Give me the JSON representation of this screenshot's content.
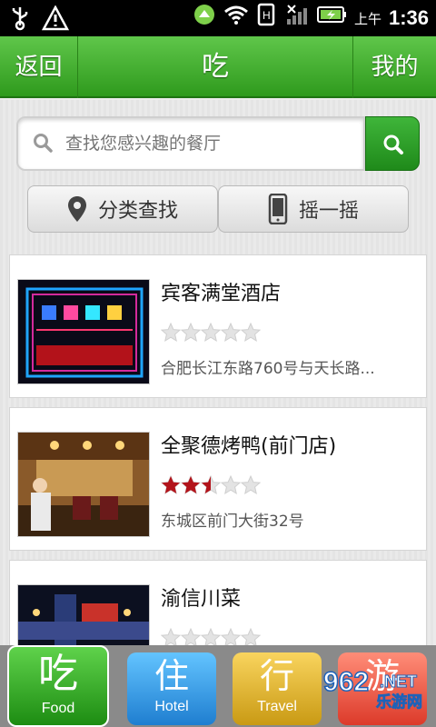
{
  "statusbar": {
    "ampm": "上午",
    "time": "1:36"
  },
  "titlebar": {
    "back_label": "返回",
    "title": "吃",
    "mine_label": "我的"
  },
  "search": {
    "placeholder": "查找您感兴趣的餐厅"
  },
  "tools": {
    "category_label": "分类查找",
    "shake_label": "摇一摇"
  },
  "restaurants": [
    {
      "name": "宾客满堂酒店",
      "rating": 0,
      "address": "合肥长江东路760号与天长路..."
    },
    {
      "name": "全聚德烤鸭(前门店)",
      "rating": 2.5,
      "address": "东城区前门大街32号"
    },
    {
      "name": "渝信川菜",
      "rating": 0,
      "address": ""
    }
  ],
  "tabs": [
    {
      "cn": "吃",
      "en": "Food"
    },
    {
      "cn": "住",
      "en": "Hotel"
    },
    {
      "cn": "行",
      "en": "Travel"
    },
    {
      "cn": "游",
      "en": ""
    }
  ],
  "watermark": {
    "text1": "962",
    "text2": "乐游网",
    "text3": ".NET"
  },
  "colors": {
    "brand_green": "#2f9a1d",
    "star_red": "#b3141b",
    "star_empty": "#e3e3e3"
  }
}
